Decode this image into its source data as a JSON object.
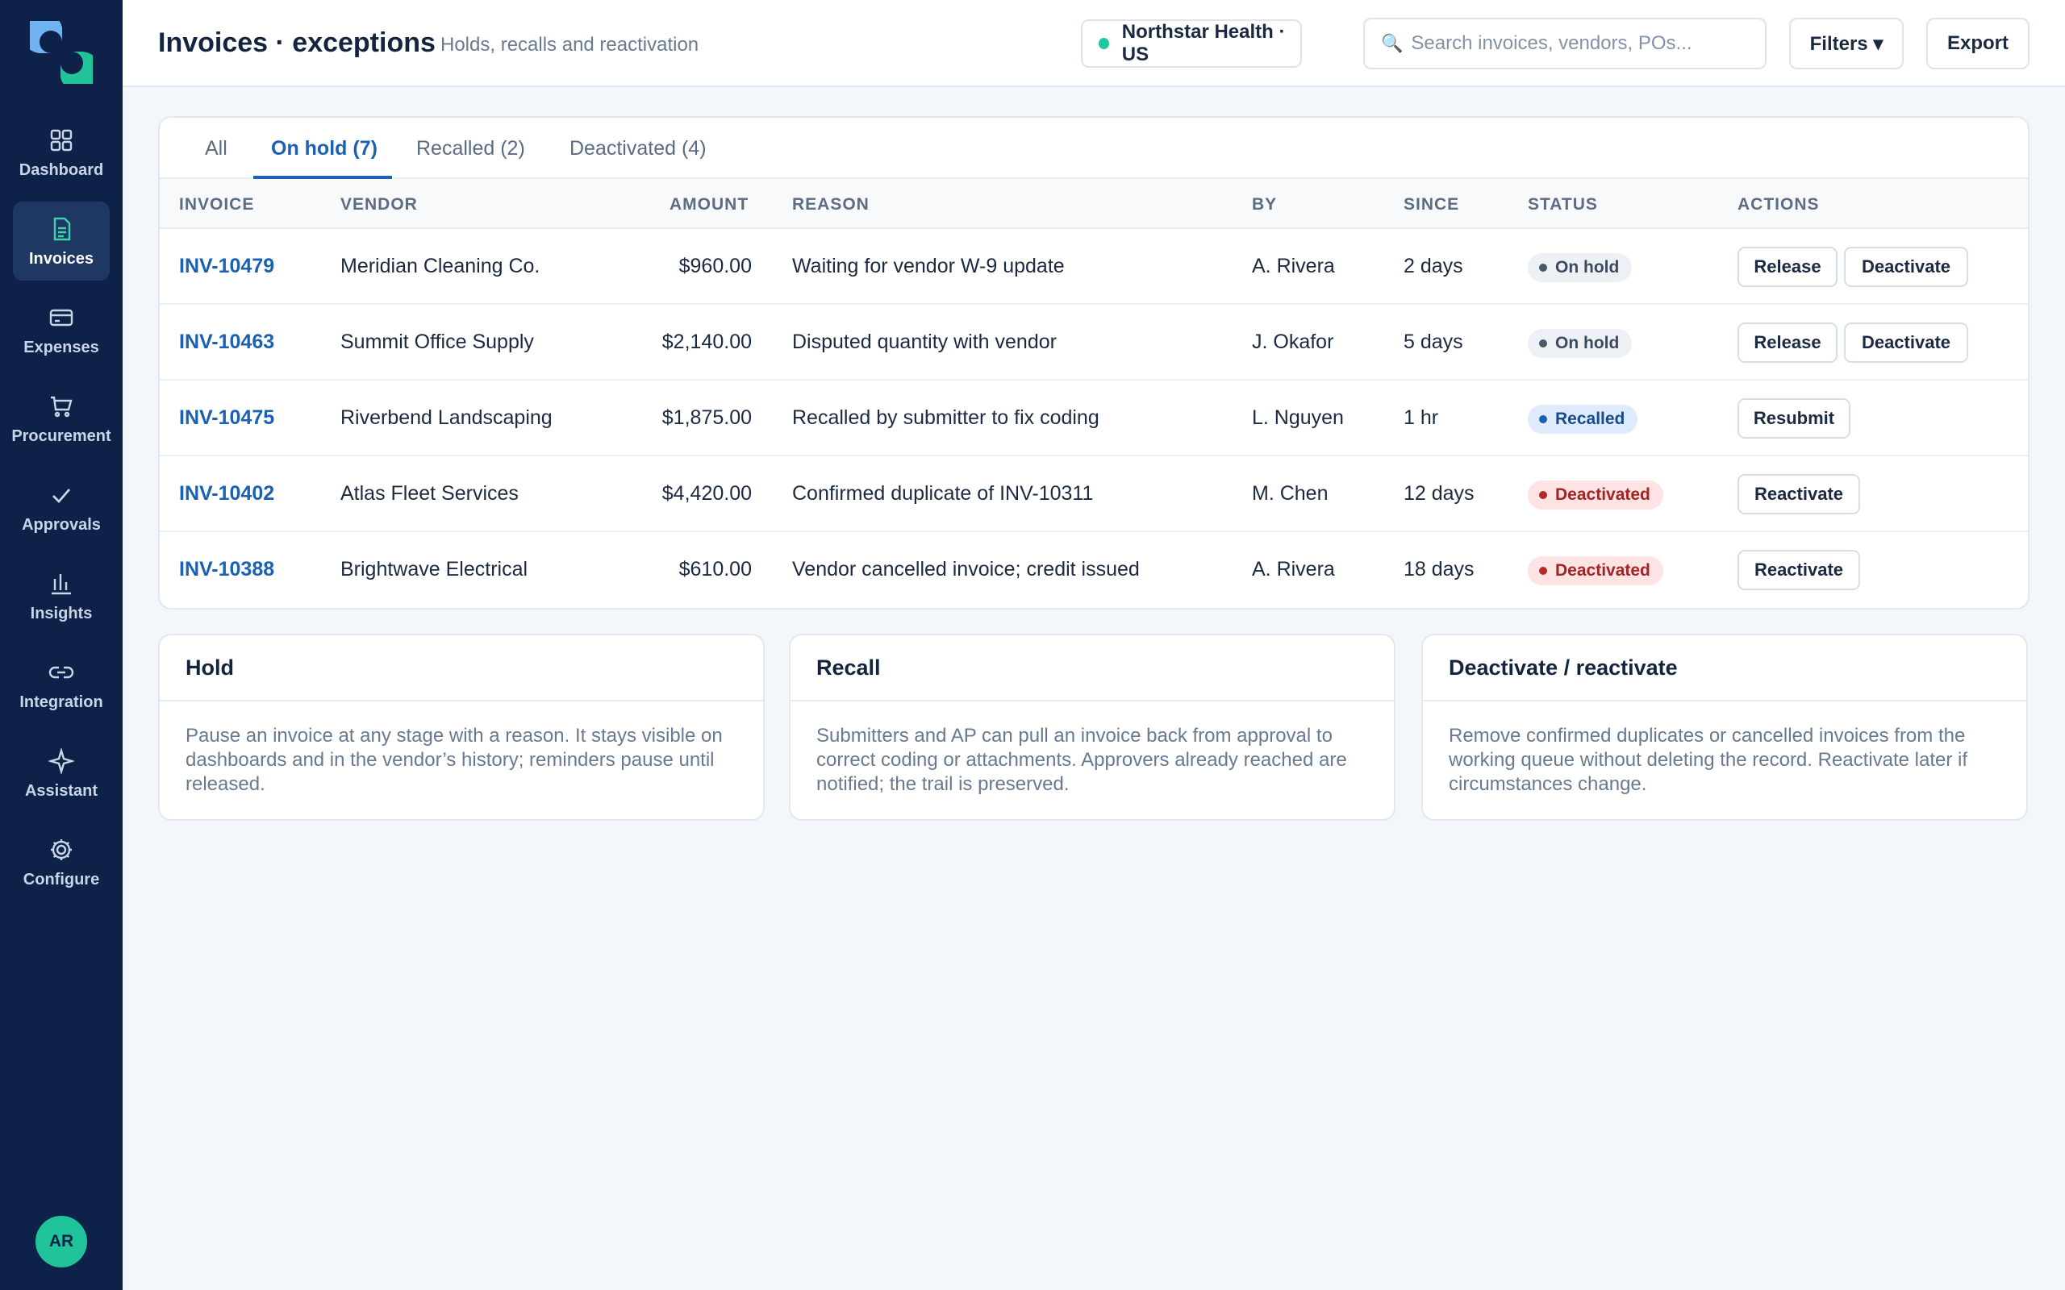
{
  "app": {
    "title": "Invoices · exceptions",
    "subtitle": "Holds, recalls and reactivation",
    "brand_color": "#20c39a",
    "sidebar_color": "#0e2148",
    "accent": "#1a61b3"
  },
  "sidebar": {
    "items": [
      {
        "label": "Dashboard",
        "icon": "grid-icon",
        "active": false
      },
      {
        "label": "Invoices",
        "icon": "document-icon",
        "active": true
      },
      {
        "label": "Expenses",
        "icon": "card-icon",
        "active": false
      },
      {
        "label": "Procurement",
        "icon": "cart-icon",
        "active": false
      },
      {
        "label": "Approvals",
        "icon": "check-icon",
        "active": false
      },
      {
        "label": "Insights",
        "icon": "bar-chart-icon",
        "active": false
      },
      {
        "label": "Integration",
        "icon": "link-icon",
        "active": false
      },
      {
        "label": "Assistant",
        "icon": "sparkle-icon",
        "active": false
      },
      {
        "label": "Configure",
        "icon": "gear-icon",
        "active": false
      }
    ],
    "avatar_initials": "AR"
  },
  "header": {
    "org": "Northstar Health · US",
    "search_placeholder": "Search invoices, vendors, POs...",
    "filters_label": "Filters ▾",
    "export_label": "Export"
  },
  "tabs": [
    {
      "label": "All",
      "active": false
    },
    {
      "label": "On hold (7)",
      "active": true
    },
    {
      "label": "Recalled (2)",
      "active": false
    },
    {
      "label": "Deactivated (4)",
      "active": false
    }
  ],
  "table": {
    "columns": {
      "invoice": "INVOICE",
      "vendor": "VENDOR",
      "amount": "AMOUNT",
      "reason": "REASON",
      "by": "BY",
      "since": "SINCE",
      "status": "STATUS",
      "actions": "ACTIONS"
    },
    "rows": [
      {
        "invoice": "INV-10479",
        "vendor": "Meridian Cleaning Co.",
        "amount": "$960.00",
        "reason": "Waiting for vendor W-9 update",
        "by": "A. Rivera",
        "since": "2 days",
        "status": "On hold",
        "status_kind": "hold",
        "actions": [
          "Release",
          "Deactivate"
        ]
      },
      {
        "invoice": "INV-10463",
        "vendor": "Summit Office Supply",
        "amount": "$2,140.00",
        "reason": "Disputed quantity with vendor",
        "by": "J. Okafor",
        "since": "5 days",
        "status": "On hold",
        "status_kind": "hold",
        "actions": [
          "Release",
          "Deactivate"
        ]
      },
      {
        "invoice": "INV-10475",
        "vendor": "Riverbend Landscaping",
        "amount": "$1,875.00",
        "reason": "Recalled by submitter to fix coding",
        "by": "L. Nguyen",
        "since": "1 hr",
        "status": "Recalled",
        "status_kind": "recalled",
        "actions": [
          "Resubmit"
        ]
      },
      {
        "invoice": "INV-10402",
        "vendor": "Atlas Fleet Services",
        "amount": "$4,420.00",
        "reason": "Confirmed duplicate of INV-10311",
        "by": "M. Chen",
        "since": "12 days",
        "status": "Deactivated",
        "status_kind": "deact",
        "actions": [
          "Reactivate"
        ]
      },
      {
        "invoice": "INV-10388",
        "vendor": "Brightwave Electrical",
        "amount": "$610.00",
        "reason": "Vendor cancelled invoice; credit issued",
        "by": "A. Rivera",
        "since": "18 days",
        "status": "Deactivated",
        "status_kind": "deact",
        "actions": [
          "Reactivate"
        ]
      }
    ]
  },
  "info_cards": [
    {
      "title": "Hold",
      "body": "Pause an invoice at any stage with a reason. It stays visible on dashboards and in the vendor’s history; reminders pause until released."
    },
    {
      "title": "Recall",
      "body": "Submitters and AP can pull an invoice back from approval to correct coding or attachments. Approvers already reached are notified; the trail is preserved."
    },
    {
      "title": "Deactivate / reactivate",
      "body": "Remove confirmed duplicates or cancelled invoices from the working queue without deleting the record. Reactivate later if circumstances change."
    }
  ]
}
